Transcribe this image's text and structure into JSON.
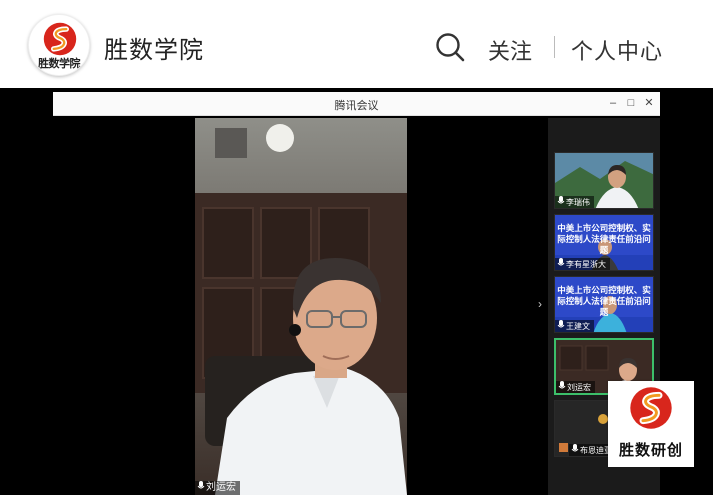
{
  "header": {
    "logo_text": "胜数学院",
    "site_name": "胜数学院",
    "follow_label": "关注",
    "user_center_label": "个人中心",
    "search_icon": "search-icon"
  },
  "meeting": {
    "window_title": "腾讯会议",
    "window_controls": [
      "minimize-icon",
      "maximize-icon",
      "close-icon"
    ],
    "active_speaker": "刘运宏",
    "participants": [
      {
        "name": "李瑞伟",
        "type": "camera"
      },
      {
        "name": "李有星浙大",
        "type": "slide",
        "slide_title": "中美上市公司控制权、实际控制人法律责任前沿问题"
      },
      {
        "name": "王建文",
        "type": "slide",
        "slide_title": "中美上市公司控制权、实际控制人法律责任前沿问题"
      },
      {
        "name": "刘运宏",
        "type": "camera",
        "active": true
      },
      {
        "name": "布恩迪亚",
        "type": "avatar"
      }
    ],
    "side_panel_toggle_icon": "chevron-right-icon"
  },
  "watermark": {
    "text": "胜数研创",
    "colors": {
      "red": "#d8261c",
      "orange": "#f29a22"
    }
  }
}
